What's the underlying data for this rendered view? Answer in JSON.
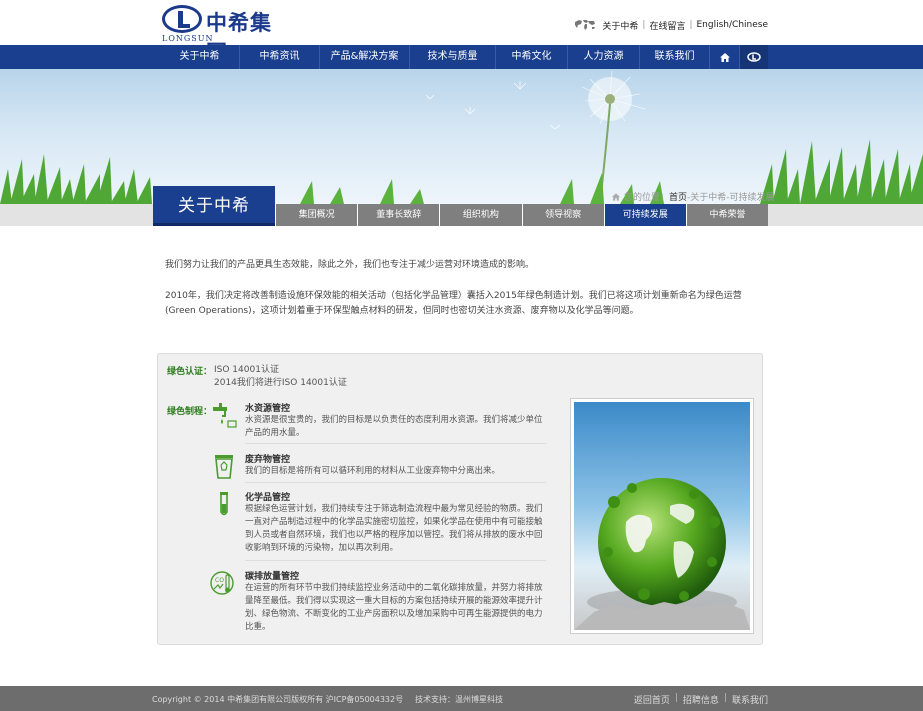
{
  "header": {
    "logo_cn": "中希集团",
    "logo_en": "LONGSUN",
    "links": [
      "关于中希",
      "在线留言",
      "English/Chinese"
    ]
  },
  "nav": {
    "items": [
      "关于中希",
      "中希资讯",
      "产品&解决方案",
      "技术与质量",
      "中希文化",
      "人力资源",
      "联系我们"
    ]
  },
  "section": {
    "title": "关于中希",
    "breadcrumb_prefix": "您的位置：",
    "breadcrumb_home": "首页",
    "breadcrumb_rest": "-关于中希-可持续发展"
  },
  "subtabs": {
    "items": [
      "集团概况",
      "董事长致辞",
      "组织机构",
      "领导视察",
      "可持续发展",
      "中希荣誉"
    ],
    "active_index": 4
  },
  "intro": {
    "p1": "我们努力让我们的产品更具生态效能，除此之外，我们也专注于减少运营对环境造成的影响。",
    "p2": "2010年，我们决定将改善制造设施环保效能的相关活动（包括化学品管理）囊括入2015年绿色制造计划。我们已将这项计划重新命名为绿色运营(Green Operations)，这项计划着重于环保型触点材料的研发，但同时也密切关注水资源、废弃物以及化学品等问题。"
  },
  "green": {
    "cert_label": "绿色认证：",
    "cert_lines": [
      "ISO 14001认证",
      "2014我们将进行ISO 14001认证"
    ],
    "mfg_label": "绿色制程：",
    "items": [
      {
        "title": "水资源管控",
        "desc": "水资源是很宝贵的，我们的目标是以负责任的态度利用水资源。我们将减少单位产品的用水量。",
        "icon": "water-tap-icon"
      },
      {
        "title": "废弃物管控",
        "desc": "我们的目标是将所有可以循环利用的材料从工业废弃物中分离出来。",
        "icon": "recycle-bin-icon"
      },
      {
        "title": "化学品管控",
        "desc": "根据绿色运营计划，我们持续专注于筛选制造流程中最为常见经验的物质。我们一直对产品制造过程中的化学品实施密切监控，如果化学品在使用中有可能接触到人员或者自然环境，我们也以严格的程序加以管控。我们将从排放的废水中回收影响到环境的污染物，加以再次利用。",
        "icon": "test-tube-icon"
      },
      {
        "title": "碳排放量管控",
        "desc": "在运营的所有环节中我们持续监控业务活动中的二氧化碳排放量，并努力将排放量降至最低。我们得以实现这一重大目标的方案包括持续开展的能源效率提升计划、绿色物流、不断变化的工业产房面积以及增加采购中可再生能源提供的电力比重。",
        "icon": "carbon-thermometer-icon"
      }
    ]
  },
  "footer": {
    "copyright": "Copyright © 2014 中希集团有限公司版权所有 沪ICP备05004332号",
    "support": "技术支持：温州博星科技",
    "links": [
      "返回首页",
      "招聘信息",
      "联系我们"
    ]
  },
  "colors": {
    "brand_blue": "#1b3f8f",
    "green_label": "#2e7d1e",
    "tab_gray": "#7f7f7f",
    "footer_gray": "#6d6d6d"
  }
}
